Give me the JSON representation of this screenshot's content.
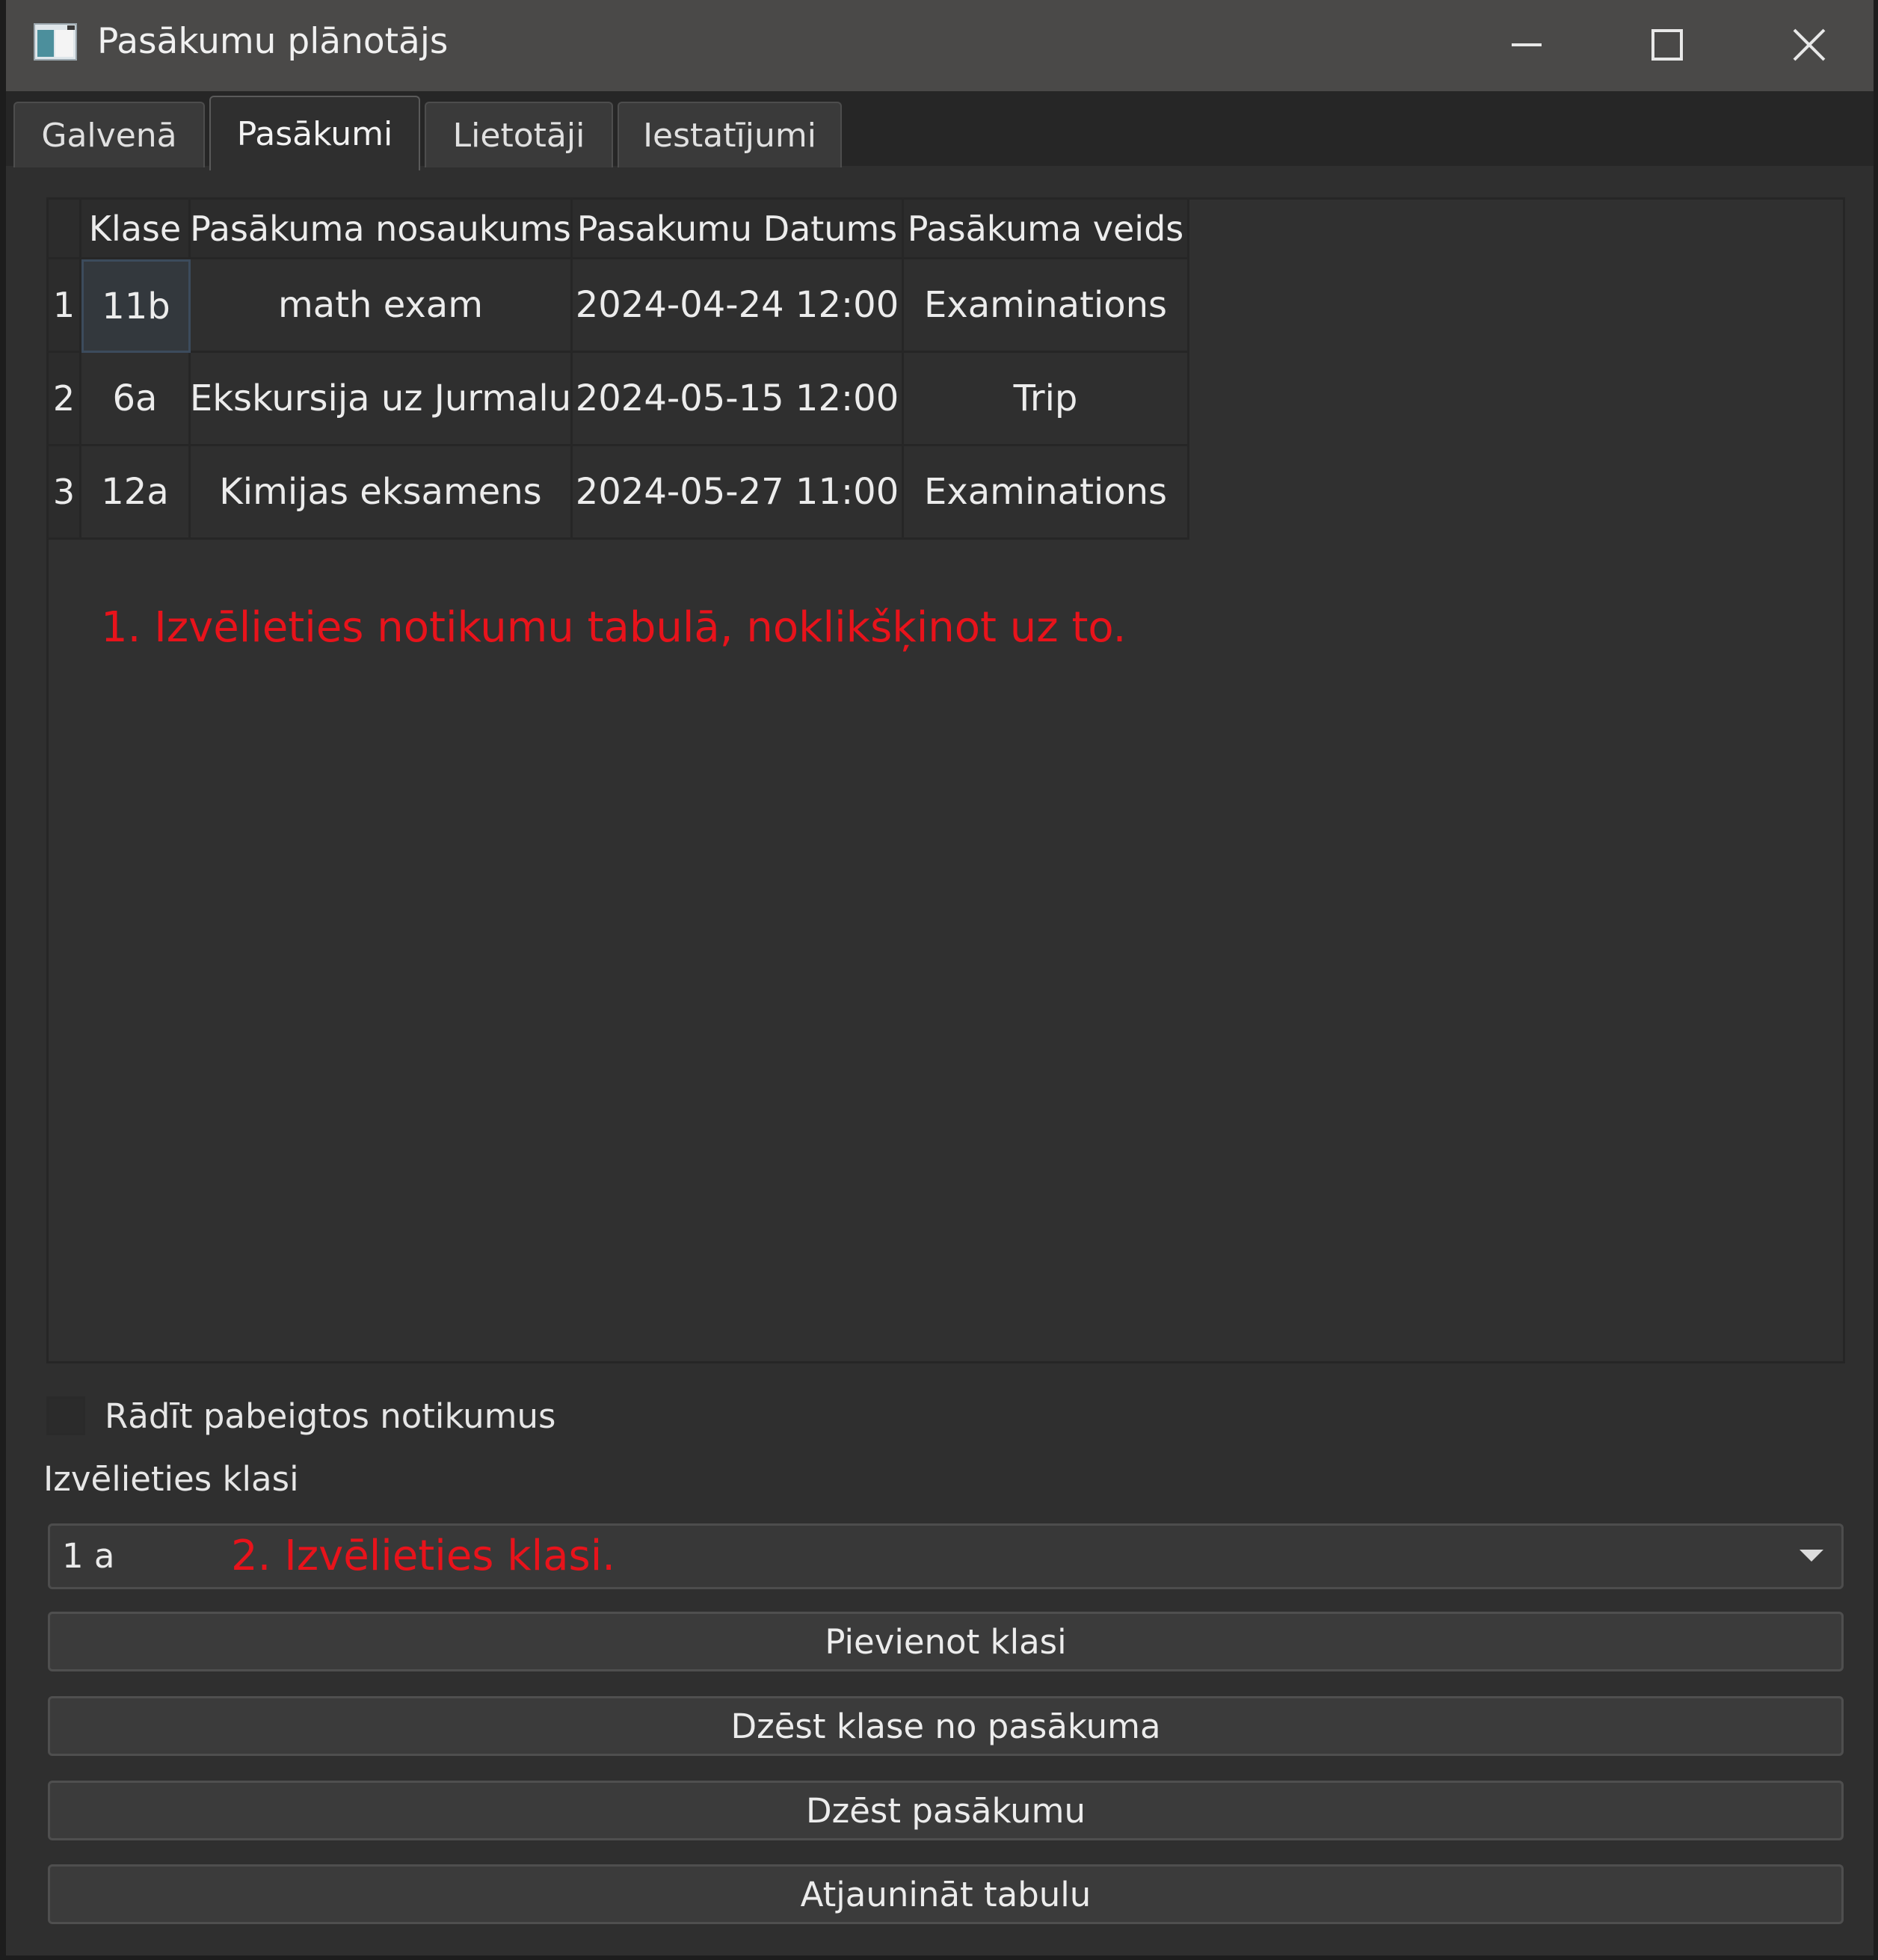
{
  "window": {
    "title": "Pasākumu plānotājs",
    "controls": {
      "minimize": "minimize-icon",
      "maximize": "maximize-icon",
      "close": "close-icon"
    }
  },
  "tabs": [
    {
      "label": "Galvenā",
      "active": false
    },
    {
      "label": "Pasākumi",
      "active": true
    },
    {
      "label": "Lietotāji",
      "active": false
    },
    {
      "label": "Iestatījumi",
      "active": false
    }
  ],
  "table": {
    "columns": [
      "Klase",
      "Pasākuma nosaukums",
      "Pasakumu Datums",
      "Pasākuma veids"
    ],
    "rows": [
      {
        "num": "1",
        "cells": [
          "11b",
          "math exam",
          "2024-04-24 12:00",
          "Examinations"
        ],
        "selected_col": 0
      },
      {
        "num": "2",
        "cells": [
          "6a",
          "Ekskursija uz Jurmalu",
          "2024-05-15 12:00",
          "Trip"
        ]
      },
      {
        "num": "3",
        "cells": [
          "12a",
          "Kimijas eksamens",
          "2024-05-27 11:00",
          "Examinations"
        ]
      }
    ]
  },
  "annotations": {
    "step1": "1. Izvēlieties notikumu tabulā, noklikšķinot uz to.",
    "step2": "2. Izvēlieties klasi."
  },
  "show_finished": {
    "label": "Rādīt pabeigtos notikumus",
    "checked": false
  },
  "class_select": {
    "label": "Izvēlieties klasi",
    "value": "1 a"
  },
  "buttons": {
    "add_class": "Pievienot klasi",
    "remove_class": "Dzēst klase no pasākuma",
    "delete_event": "Dzēst pasākumu",
    "refresh": "Atjaunināt tabulu"
  },
  "colors": {
    "annotation": "#e8131b",
    "background": "#2f2f2f",
    "titlebar": "#4a4948"
  }
}
